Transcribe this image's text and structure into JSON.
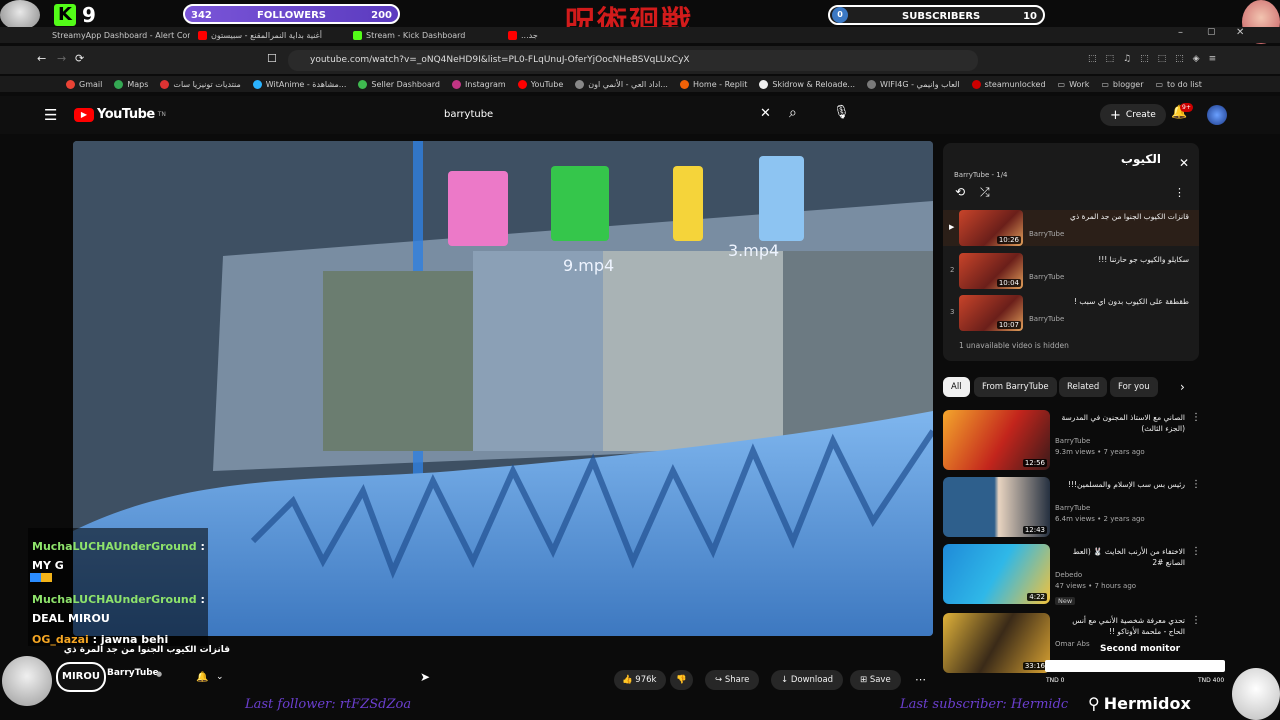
{
  "stream_overlay": {
    "kick_count": "9",
    "followers": {
      "current": "342",
      "label": "FOLLOWERS",
      "goal": "200"
    },
    "subscribers": {
      "current": "0",
      "label": "SUBSCRIBERS",
      "goal": "10"
    },
    "last_follower": "Last follower: rtFZSdZoa",
    "last_subscriber": "Last subscriber: Hermidc",
    "streamer_name": "Hermidox",
    "second_monitor": "Second monitor",
    "tnd_left": "TND 0",
    "tnd_right": "TND 400",
    "colors": {
      "kick_green": "#53fc18",
      "followers_bar": "#6a3fcf"
    }
  },
  "browser": {
    "tabs": [
      {
        "label": "StreamyApp Dashboard - Alert Conf",
        "icon": "streamyapp-icon"
      },
      {
        "label": "أغنية بداية النمرالمقنع - سبيستون",
        "icon": "youtube-icon"
      },
      {
        "label": "Stream - Kick Dashboard",
        "icon": "kick-icon"
      },
      {
        "label": "...جد",
        "icon": "youtube-icon"
      }
    ],
    "url": "youtube.com/watch?v=_oNQ4NeHD9I&list=PL0-FLqUnuJ-OferYjOocNHeBSVqLUxCyX",
    "bookmarks": [
      {
        "label": "Gmail"
      },
      {
        "label": "Maps"
      },
      {
        "label": "منتديات تونيزيا سات"
      },
      {
        "label": "WitAnime - مشاهدة..."
      },
      {
        "label": "Seller Dashboard"
      },
      {
        "label": "Instagram"
      },
      {
        "label": "YouTube"
      },
      {
        "label": "اداد العي - الأنمي اون..."
      },
      {
        "label": "Home - Replit"
      },
      {
        "label": "Skidrow & Reloade..."
      },
      {
        "label": "WIFI4G - العاب وانيمي"
      },
      {
        "label": "steamunlocked"
      },
      {
        "label": "Work"
      },
      {
        "label": "blogger"
      },
      {
        "label": "to do list"
      }
    ]
  },
  "youtube": {
    "logo": "YouTube",
    "logo_region": "TN",
    "search_value": "barrytube",
    "create_label": "Create",
    "notif_badge": "9+",
    "video": {
      "title": "قانزات الكيوب الجنوا من جد المرة ذي",
      "channel": "BarryTube",
      "likes": "976k",
      "share_label": "Share",
      "download_label": "Download",
      "save_label": "Save",
      "clip_labels": [
        "9.mp4",
        "3.mp4"
      ]
    },
    "playlist": {
      "title": "الكيوب",
      "channel_progress": "BarryTube - 1/4",
      "items": [
        {
          "index": "▶",
          "title": "قانزات الكيوب الجنوا من جد المرة ذي",
          "channel": "BarryTube",
          "duration": "10:26"
        },
        {
          "index": "2",
          "title": "سكايلو والكيوب جو حارتنا !!!",
          "channel": "BarryTube",
          "duration": "10:04"
        },
        {
          "index": "3",
          "title": "طقطقة على الكيوب بدون اي سبب !",
          "channel": "BarryTube",
          "duration": "10:07"
        }
      ],
      "hidden_note": "1 unavailable video is hidden"
    },
    "chips": [
      "All",
      "From BarryTube",
      "Related",
      "For you"
    ],
    "recommendations": [
      {
        "title": "الصاني مع الاستاذ المجنون في المدرسة (الجزء الثالث)",
        "channel": "BarryTube",
        "meta": "9.3m views • 7 years ago",
        "duration": "12:56",
        "badge": ""
      },
      {
        "title": "رئيس بس سب الإسلام والمسلمين!!!",
        "channel": "BarryTube",
        "meta": "6.4m views • 2 years ago",
        "duration": "12:43",
        "badge": ""
      },
      {
        "title": "الاختفاء من الأرنب الخايث 🐰 (العط الصانع #2",
        "channel": "Debedo",
        "meta": "47 views • 7 hours ago",
        "duration": "4:22",
        "badge": "New"
      },
      {
        "title": "تحدي معرفة شخصية الأنمي مع أنس الحاج - ملحمة الأوتاكو !!",
        "channel": "Omar Abs",
        "meta": "",
        "duration": "33:16",
        "badge": ""
      }
    ]
  },
  "chat": [
    {
      "name": "MuchaLUCHAUnderGround",
      "message": "MY G"
    },
    {
      "name": "MuchaLUCHAUnderGround",
      "message": "DEAL MIROU"
    },
    {
      "name": "OG_dazai",
      "message": "jawna behi"
    }
  ]
}
